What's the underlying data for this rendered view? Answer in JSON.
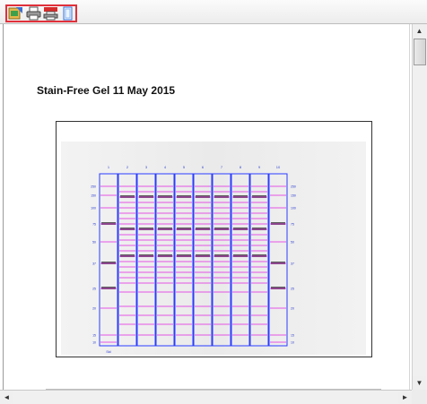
{
  "toolbar": {
    "buttons": [
      {
        "name": "export-icon"
      },
      {
        "name": "print-icon"
      },
      {
        "name": "print-pdf-icon"
      },
      {
        "name": "page-setup-icon"
      }
    ],
    "accent_color": "#e0303a"
  },
  "report": {
    "title": "Stain-Free Gel 11 May 2015"
  },
  "gel": {
    "lane_numbers": [
      "1",
      "2",
      "3",
      "4",
      "5",
      "6",
      "7",
      "8",
      "9",
      "10"
    ],
    "lane_color": "#2a3cff",
    "band_color": "#e020e0",
    "ladder_labels_left": [
      "250",
      "150",
      "100",
      "75",
      "50",
      "37",
      "25",
      "20",
      "15",
      "10"
    ],
    "ladder_labels_right": [
      "250",
      "150",
      "100",
      "75",
      "50",
      "37",
      "25",
      "20",
      "15",
      "10"
    ],
    "lane_footer": "Std"
  },
  "scrollbars": {
    "vertical": {
      "up": "▲",
      "down": "▼",
      "position": 0.02
    },
    "horizontal": {
      "left": "◄",
      "right": "►",
      "position": 0.0
    }
  }
}
